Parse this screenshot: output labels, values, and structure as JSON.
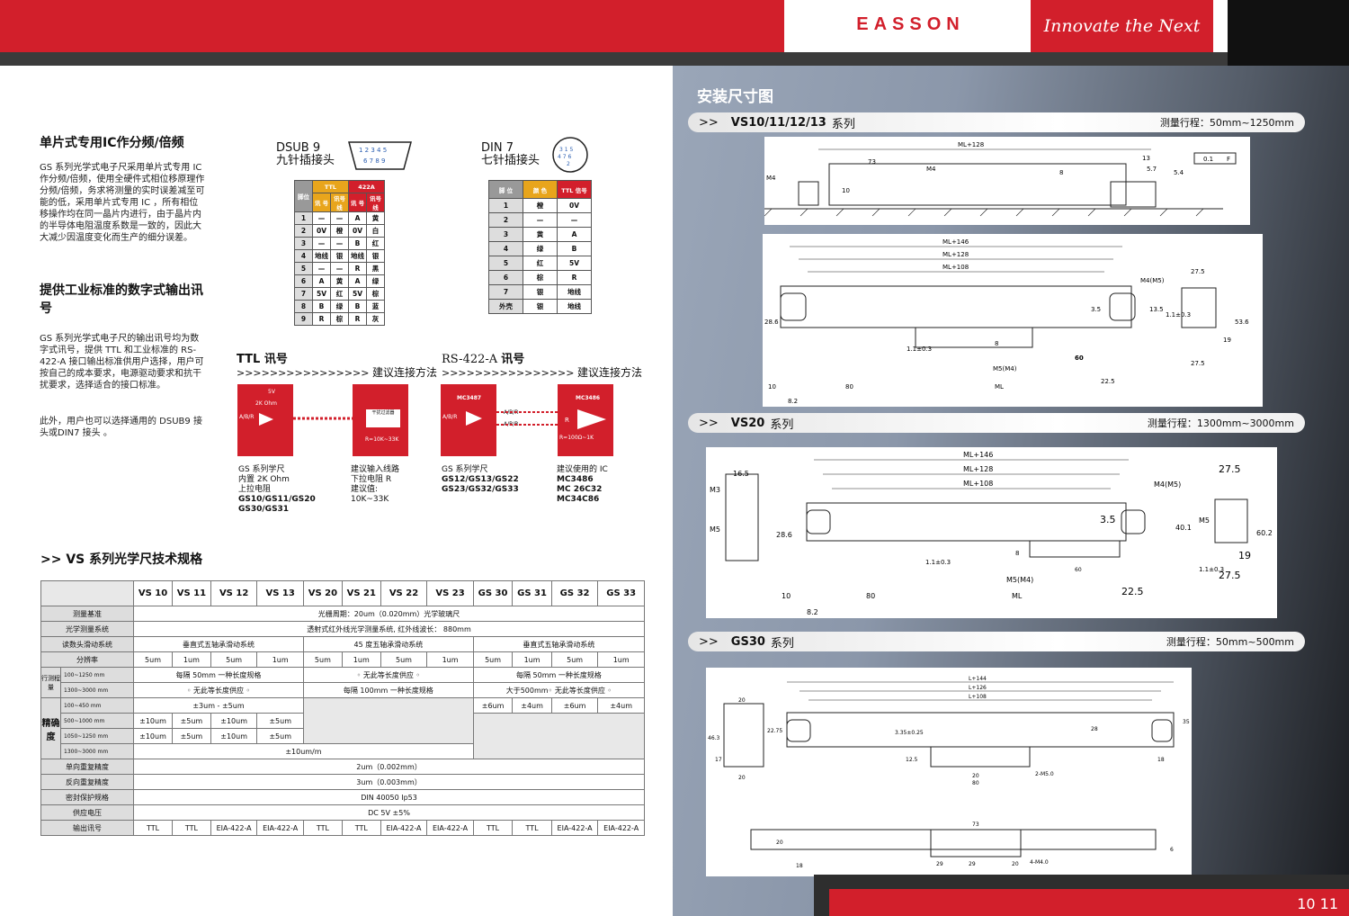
{
  "header": {
    "logo": "EASSON",
    "slogan": "Innovate the Next"
  },
  "left": {
    "h1": "单片式专用IC作分频/倍频",
    "p1": "GS 系列光学式电子尺采用单片式专用 IC 作分频/倍频，使用全硬件式相位移原理作分频/倍频，务求将测量的实时误差减至可能的低，采用单片式专用 IC ，所有相位移操作均在同一晶片内进行，由于晶片内的半导体电阻温度系数是一致的，因此大大减少因温度变化而生产的细分误差。",
    "h2": "提供工业标准的数字式输出讯号",
    "p2": "GS 系列光学式电子尺的输出讯号均为数字式讯号，提供 TTL 和工业标准的 RS-422-A 接口输出标准供用户选择，用户可按自己的成本要求，电源驱动要求和抗干扰要求，选择适合的接口标准。",
    "p3": "此外，用户也可以选择通用的 DSUB9 接头或DIN7 接头 。"
  },
  "dsub": {
    "title": "DSUB 9",
    "subtitle": "九针插接头",
    "head": [
      "脚位",
      "TTL",
      "422A"
    ],
    "sub": [
      "讯 号",
      "讯号线",
      "讯 号",
      "讯号线"
    ],
    "rows": [
      [
        "1",
        "—",
        "—",
        "A",
        "黄"
      ],
      [
        "2",
        "0V",
        "橙",
        "0V",
        "白"
      ],
      [
        "3",
        "—",
        "—",
        "B",
        "红"
      ],
      [
        "4",
        "地线",
        "银",
        "地线",
        "银"
      ],
      [
        "5",
        "—",
        "—",
        "R",
        "黑"
      ],
      [
        "6",
        "A",
        "黄",
        "A",
        "绿"
      ],
      [
        "7",
        "5V",
        "红",
        "5V",
        "棕"
      ],
      [
        "8",
        "B",
        "绿",
        "B",
        "蓝"
      ],
      [
        "9",
        "R",
        "棕",
        "R",
        "灰"
      ]
    ]
  },
  "din": {
    "title": "DIN 7",
    "subtitle": "七针插接头",
    "head": [
      "脚 位",
      "颜 色",
      "TTL 信号"
    ],
    "rows": [
      [
        "1",
        "橙",
        "0V"
      ],
      [
        "2",
        "—",
        "—"
      ],
      [
        "3",
        "黄",
        "A"
      ],
      [
        "4",
        "绿",
        "B"
      ],
      [
        "5",
        "红",
        "5V"
      ],
      [
        "6",
        "棕",
        "R"
      ],
      [
        "7",
        "银",
        "地线"
      ],
      [
        "外壳",
        "银",
        "地线"
      ]
    ]
  },
  "ttl": {
    "title": "TTL 讯号",
    "arrows": ">>>>>>>>>>>>>>>>",
    "suggest": "建议连接方法",
    "v5": "5V",
    "ohm": "2K Ohm",
    "abr": "A/B/R",
    "filter": "干扰过滤器",
    "rr": "R=10K~33K",
    "cap1": [
      "GS 系列学尺",
      "内置 2K Ohm",
      "上拉电阻"
    ],
    "cap1b": [
      "GS10/GS11/GS20",
      "GS30/GS31"
    ],
    "cap2": [
      "建议输入线路",
      "下拉电阻 R",
      "建议值:",
      "10K~33K"
    ]
  },
  "rs": {
    "title": "RS-422-A",
    "title2": "讯号",
    "arrows": ">>>>>>>>>>>>>>>>",
    "suggest": "建议连接方法",
    "mc1": "MC3487",
    "mc2": "MC3486",
    "abr": "A/B/R",
    "abr1": "A/B/R",
    "abr2": "A/B/R",
    "rr": "R=100Ω~1K",
    "r": "R",
    "cap1": [
      "GS 系列学尺"
    ],
    "cap1b": [
      "GS12/GS13/GS22",
      "GS23/GS32/GS33"
    ],
    "cap2": [
      "建议使用的 IC"
    ],
    "cap2b": [
      "MC3486",
      "MC 26C32",
      "MC34C86"
    ]
  },
  "spec": {
    "title": ">> VS 系列光学尺技术规格",
    "models": [
      "VS 10",
      "VS 11",
      "VS 12",
      "VS 13",
      "VS 20",
      "VS 21",
      "VS 22",
      "VS 23",
      "GS 30",
      "GS 31",
      "GS 32",
      "GS 33"
    ],
    "r_base": [
      "测量基准",
      "光栅周期：20um（0.020mm）光学玻璃尺"
    ],
    "r_sys": [
      "光学测量系统",
      "透射式红外线光学测量系统, 红外线波长： 880mm"
    ],
    "r_slide": [
      "读数头滑动系统",
      "垂直式五轴承滑动系统",
      "45 度五轴承滑动系统",
      "垂直式五轴承滑动系统"
    ],
    "r_res": [
      "分辨率",
      "5um",
      "1um",
      "5um",
      "1um",
      "5um",
      "1um",
      "5um",
      "1um",
      "5um",
      "1um",
      "5um",
      "1um"
    ],
    "travel": "行测程量",
    "t1": [
      "100~1250 mm",
      "每隔 50mm 一种长度规格",
      "◦ 无此等长度供应 ◦",
      "每隔 50mm 一种长度规格"
    ],
    "t2": [
      "1300~3000 mm",
      "◦ 无此等长度供应 ◦",
      "每隔 100mm 一种长度规格",
      "大于500mm◦ 无此等长度供应 ◦"
    ],
    "acc": "精确度",
    "a1": [
      "100~450 mm",
      "±3um - ±5um",
      "±6um",
      "±4um",
      "±6um",
      "±4um"
    ],
    "a2": [
      "500~1000 mm",
      "±10um",
      "±5um",
      "±10um",
      "±5um"
    ],
    "a3": [
      "1050~1250 mm",
      "±10um",
      "±5um",
      "±10um",
      "±5um"
    ],
    "a4": [
      "1300~3000 mm",
      "±10um/m"
    ],
    "r_rep": [
      "单向重复精度",
      "2um（0.002mm）"
    ],
    "r_rrep": [
      "反向重复精度",
      "3um（0.003mm）"
    ],
    "r_seal": [
      "密封保护规格",
      "DIN 40050 Ip53"
    ],
    "r_pwr": [
      "供应电压",
      "DC 5V ±5%"
    ],
    "r_out": [
      "输出讯号",
      "TTL",
      "TTL",
      "EIA-422-A",
      "EIA-422-A",
      "TTL",
      "TTL",
      "EIA-422-A",
      "EIA-422-A",
      "TTL",
      "TTL",
      "EIA-422-A",
      "EIA-422-A"
    ]
  },
  "right": {
    "title": "安装尺寸图",
    "s1": {
      "arrow": ">>",
      "name": "VS10/11/12/13",
      "suffix": "系列",
      "range": "测量行程：50mm~1250mm"
    },
    "s2": {
      "arrow": ">>",
      "name": "VS20",
      "suffix": "系列",
      "range": "测量行程：1300mm~3000mm"
    },
    "s3": {
      "arrow": ">>",
      "name": "GS30",
      "suffix": "系列",
      "range": "测量行程：50mm~500mm"
    },
    "d1": [
      "ML+128",
      "73",
      "M4",
      "13",
      "5.7",
      "0.1",
      "F",
      "M4",
      "10",
      "8",
      "5.4"
    ],
    "d2": [
      "ML+146",
      "ML+128",
      "ML+108",
      "M4(M5)",
      "27.5",
      "3.5",
      "13.5",
      "1.1±0.3",
      "53.6",
      "28.6",
      "1.1±0.3",
      "8",
      "60",
      "M5(M4)",
      "27.5",
      "19",
      "10",
      "80",
      "ML",
      "22.5",
      "8.2"
    ],
    "d3": [
      "ML+146",
      "ML+128",
      "ML+108",
      "16.5",
      "M3",
      "M5",
      "27.5",
      "M4(M5)",
      "3.5",
      "40.1",
      "M5",
      "60.2",
      "28.6",
      "1.1±0.3",
      "8",
      "60",
      "M5(M4)",
      "19",
      "1.1±0.3",
      "27.5",
      "10",
      "80",
      "ML",
      "22.5",
      "8.2"
    ],
    "d4": [
      "L+144",
      "L+126",
      "L+108",
      "20",
      "20",
      "46.3",
      "22.75",
      "17",
      "3.35±0.25",
      "28",
      "12.5",
      "2-M5.0",
      "80",
      "20",
      "18",
      "35",
      "20",
      "73",
      "4-M4.0",
      "18",
      "29",
      "29",
      "20",
      "6"
    ],
    "page": "10 11"
  }
}
